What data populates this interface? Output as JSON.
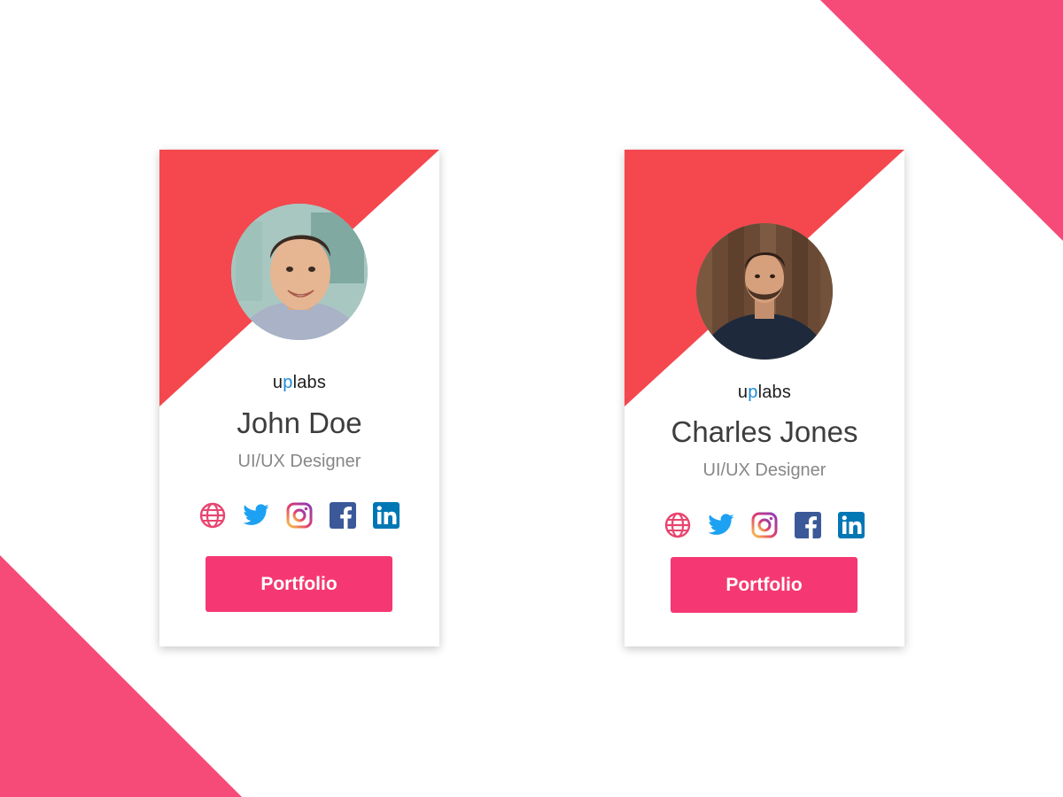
{
  "theme": {
    "card_header_color": "#f5474e",
    "button_color": "#f53873",
    "decor_color": "#f64a78",
    "brand_accent_color": "#1c8bd6"
  },
  "cards": [
    {
      "brand_prefix": "u",
      "brand_accent": "p",
      "brand_suffix": "labs",
      "name": "John Doe",
      "role": "UI/UX Designer",
      "avatar_icon": "person-photo-avatar",
      "socials": [
        "globe-icon",
        "twitter-icon",
        "instagram-icon",
        "facebook-icon",
        "linkedin-icon"
      ],
      "button_label": "Portfolio"
    },
    {
      "brand_prefix": "u",
      "brand_accent": "p",
      "brand_suffix": "labs",
      "name": "Charles Jones",
      "role": "UI/UX Designer",
      "avatar_icon": "person-photo-avatar",
      "socials": [
        "globe-icon",
        "twitter-icon",
        "instagram-icon",
        "facebook-icon",
        "linkedin-icon"
      ],
      "button_label": "Portfolio"
    }
  ]
}
